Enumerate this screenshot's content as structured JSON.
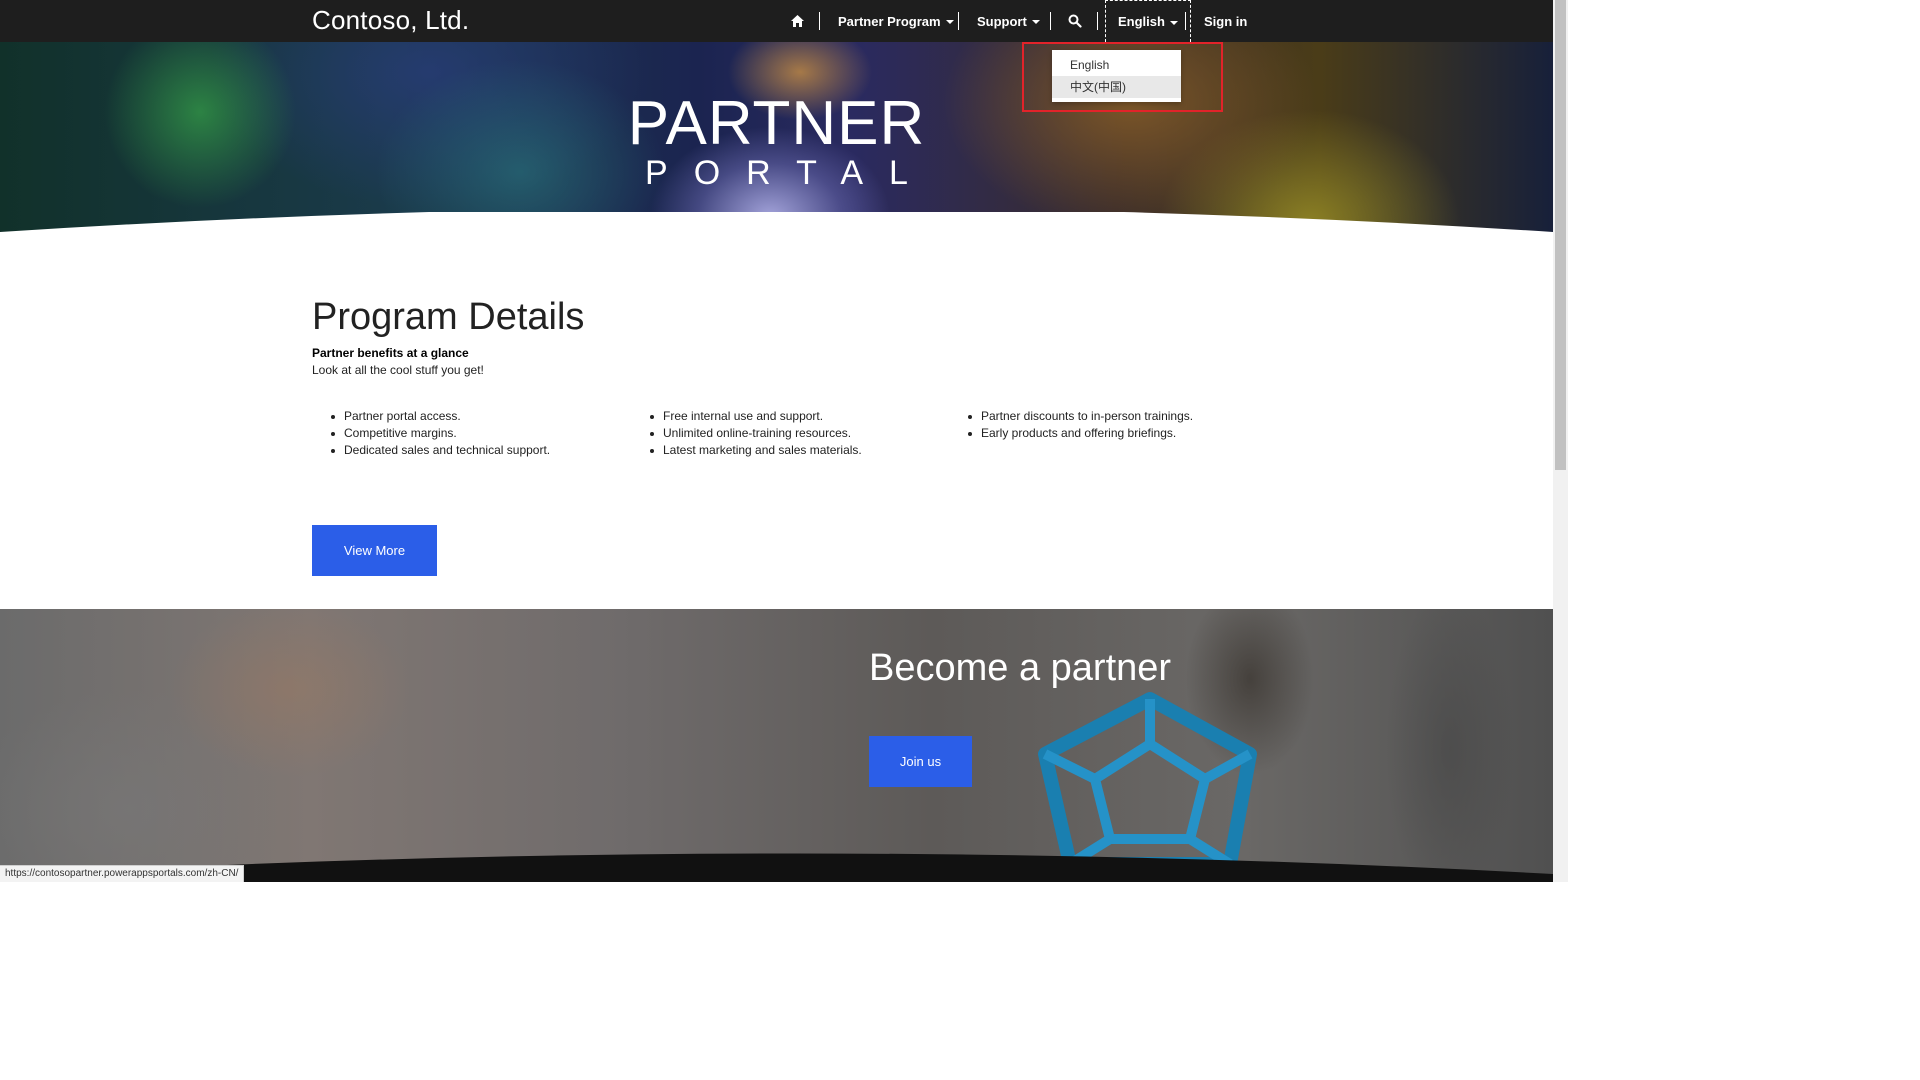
{
  "navbar": {
    "brand": "Contoso, Ltd.",
    "items": [
      {
        "label": "Partner Program"
      },
      {
        "label": "Support"
      },
      {
        "label": "English"
      },
      {
        "label": "Sign in"
      }
    ],
    "icons": [
      "home-icon",
      "search-icon"
    ]
  },
  "language_dropdown": {
    "options": [
      "English",
      "中文(中国)"
    ],
    "hovered": "中文(中国)",
    "highlight_color": "#e2232a"
  },
  "hero": {
    "line1": "PARTNER",
    "line2": "PORTAL"
  },
  "program": {
    "title": "Program Details",
    "subtitle": "Partner benefits at a glance",
    "tagline": "Look at all the cool stuff you get!",
    "col1": [
      "Partner portal access.",
      "Competitive margins.",
      "Dedicated sales and technical support."
    ],
    "col2": [
      "Free internal use and support.",
      "Unlimited online-training resources.",
      "Latest marketing and sales materials."
    ],
    "col3": [
      "Partner discounts to in-person trainings.",
      "Early products and offering briefings."
    ],
    "view_more": "View More"
  },
  "partner": {
    "title": "Become a partner",
    "join": "Join us"
  },
  "statusbar": {
    "url": "https://contosopartner.powerappsportals.com/zh-CN/"
  },
  "colors": {
    "navbar": "#1e1e1e",
    "accent_button": "#2b5ee8"
  }
}
